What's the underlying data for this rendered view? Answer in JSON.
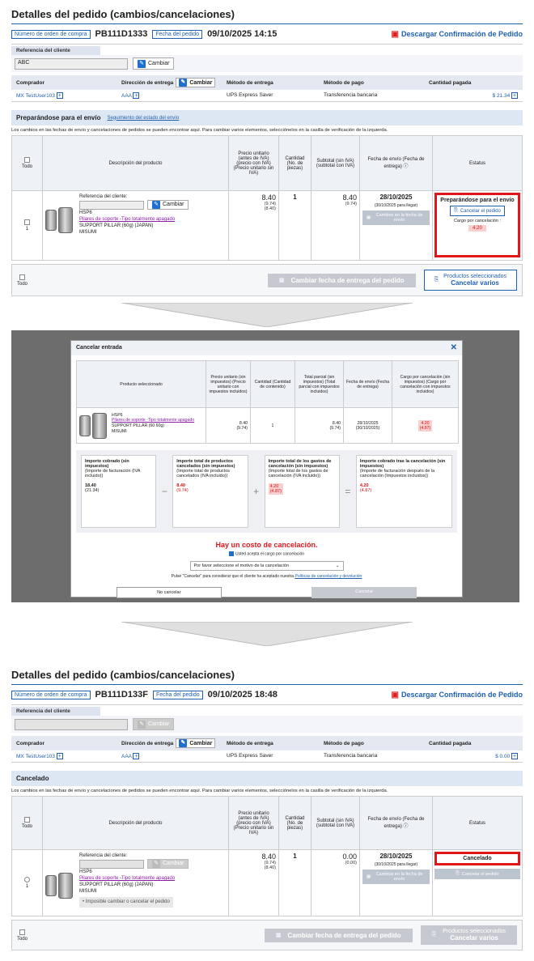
{
  "before": {
    "title": "Detalles del pedido (cambios/cancelaciones)",
    "order_tag": "Número de orden de compra",
    "order_no": "PB111D1333",
    "date_tag": "Fecha del pedido",
    "date": "09/10/2025 14:15",
    "pdf_link": "Descargar Confirmación de Pedido",
    "ref_label": "Referencia del cliente",
    "ref_value": "ABC",
    "cambiar": "Cambiar",
    "col_comprador": "Comprador",
    "col_direccion": "Dirección de entrega",
    "col_metodo_entrega": "Método de entrega",
    "col_metodo_pago": "Método de pago",
    "col_cantidad_pagada": "Cantidad pagada",
    "val_comprador": "MX TestUser103",
    "val_direccion": "AAA",
    "val_metodo_entrega": "UPS Express Saver",
    "val_metodo_pago": "Transferencia bancaria",
    "val_cantidad_pagada": "$ 21.34",
    "status_title": "Preparándose para el envío",
    "status_link": "Seguimiento del estado del envío",
    "note": "Los cambios en las fechas de envío y cancelaciones de pedidos se pueden encontrar aquí. Para cambiar varios elementos, selecciónelos en la casilla de verificación de la izquierda.",
    "th_todo": "Todo",
    "th_desc": "Descripción del producto",
    "th_precio": "Precio unitario (antes de IVA) (precio con IVA) (Precio unitario sin IVA)",
    "th_cantidad": "Cantidad (No. de piezas)",
    "th_subtotal": "Subtotal (sin IVA) (subtotal con IVA)",
    "th_fecha": "Fecha de envío (Fecha de entrega)",
    "th_estatus": "Estatus",
    "row_num": "1",
    "ref_cliente_lbl": "Referencia del cliente:",
    "sku": "HSP6",
    "prod_name": "Pilares de soporte -Tipo totalmente apagado",
    "prod_desc": "SUPPORT PILLAR (60g) (JAPAN)",
    "maker": "MISUMI",
    "price": "8.40",
    "price_iva": "(9.74)",
    "price_sin": "(8.40)",
    "qty": "1",
    "subtotal": "8.40",
    "subtotal_iva": "(9.74)",
    "ship_date": "28/10/2025",
    "deliv_date": "(30/10/2025 para llegar)",
    "btn_cambios_fecha": "Cambios en la fecha de envío",
    "status_text": "Preparándose para el envío",
    "cancel_btn": "Cancelar el pedido",
    "cargo_lbl": "Cargo por cancelación :",
    "cargo_val": "4.20",
    "bottom_change": "Cambiar fecha de entrega del pedido",
    "bottom_cancel_top": "Productos seleccionados",
    "bottom_cancel": "Cancelar varios"
  },
  "modal": {
    "title": "Cancelar entrada",
    "th_producto": "Producto seleccionado",
    "th_precio": "Precio unitario (sin impuestos) (Precio unitario con impuestos incluidos)",
    "th_cantidad": "Cantidad (Cantidad de contenido)",
    "th_total": "Total parcial (sin impuestos) (Total parcial con impuestos incluidos)",
    "th_fecha": "Fecha de envío (Fecha de entrega)",
    "th_cargo": "Cargo por cancelación (sin impuestos) (Cargo por cancelación con impuestos incluidos)",
    "sku": "HSP6",
    "prod_name": "Pilares de soporte -Tipo totalmente apagado",
    "prod_desc": "SUPPORT PILLAR (60 60g)",
    "maker": "MISUMI",
    "price": "8.40",
    "price_iva": "(9.74)",
    "qty": "1",
    "total": "8.40",
    "total_iva": "(9.74)",
    "fecha": "28/10/2025",
    "fecha2": "(30/10/2025)",
    "cargo": "4.20",
    "cargo_iva": "(4.87)",
    "box1_title": "Importe cobrado (sin impuestos)",
    "box1_sub": "(Importe de facturación (IVA incluido))",
    "box1_val": "18.40",
    "box1_val2": "(21.34)",
    "box2_title": "Importe total de productos cancelados (sin impuestos)",
    "box2_sub": "(Importe total de productos cancelados (IVA incluido))",
    "box2_val": "8.40",
    "box2_val2": "(9.74)",
    "box3_title": "Importe total de los gastos de cancelación (sin impuestos)",
    "box3_sub": "(Importe total de los gastos de cancelación (IVA incluido))",
    "box3_val": "4.20",
    "box3_val2": "(4.87)",
    "box4_title": "Importe cobrado tras la cancelación (sin impuestos)",
    "box4_sub": "(Importe de facturación después de la cancelación (Impuestos incluidos))",
    "box4_val": "4.20",
    "box4_val2": "(4.87)",
    "op_minus": "−",
    "op_plus": "+",
    "op_eq": "=",
    "warn": "Hay un costo de cancelación.",
    "accept": "Usted acepta el cargo por cancelación",
    "reason": "Por favor seleccione el motivo de la cancelación",
    "policy_pre": "Pulse \"Cancelar\" para considerar que el cliente ha aceptado nuestra",
    "policy_link": "Políticas de cancelación y devolución",
    "btn_no": "No cancelar",
    "btn_yes": "Cancelar"
  },
  "after": {
    "title": "Detalles del pedido (cambios/cancelaciones)",
    "order_tag": "Número de orden de compra",
    "order_no": "PB111D133F",
    "date_tag": "Fecha del pedido",
    "date": "09/10/2025 18:48",
    "pdf_link": "Descargar Confirmación de Pedido",
    "ref_label": "Referencia del cliente",
    "cambiar": "Cambiar",
    "col_comprador": "Comprador",
    "col_direccion": "Dirección de entrega",
    "col_metodo_entrega": "Método de entrega",
    "col_metodo_pago": "Método de pago",
    "col_cantidad_pagada": "Cantidad pagada",
    "val_comprador": "MX TestUser103",
    "val_direccion": "AAA",
    "val_metodo_entrega": "UPS Express Saver",
    "val_metodo_pago": "Transferencia bancaria",
    "val_cantidad_pagada": "$ 0.00",
    "status_title": "Cancelado",
    "note": "Los cambios en las fechas de envío y cancelaciones de pedidos se pueden encontrar aquí. Para cambiar varios elementos, selecciónelos en la casilla de verificación de la izquierda.",
    "th_todo": "Todo",
    "th_desc": "Descripción del producto",
    "th_precio": "Precio unitario (antes de IVA) (precio con IVA) (Precio unitario sin IVA)",
    "th_cantidad": "Cantidad (No. de piezas)",
    "th_subtotal": "Subtotal (sin IVA) (subtotal con IVA)",
    "th_fecha": "Fecha de envío (Fecha de entrega)",
    "th_estatus": "Estatus",
    "row_num": "1",
    "ref_cliente_lbl": "Referencia del cliente:",
    "sku": "HSP6",
    "prod_name": "Pilares de soporte -Tipo totalmente apagado",
    "prod_desc": "SUPPORT PILLAR (60g) (JAPAN)",
    "maker": "MISUMI",
    "price": "8.40",
    "price_iva": "(9.74)",
    "price_sin": "(8.40)",
    "qty": "1",
    "subtotal": "0.00",
    "subtotal_iva": "(0.00)",
    "ship_date": "28/10/2025",
    "deliv_date": "(30/10/2025 para llegar)",
    "btn_cambios_fecha": "Cambios en la fecha de envío",
    "impossible": "• Imposible cambiar o cancelar el pedido",
    "status_text": "Cancelado",
    "cancel_btn": "Cancelar el pedido",
    "bottom_change": "Cambiar fecha de entrega del pedido",
    "bottom_cancel_top": "Productos seleccionados",
    "bottom_cancel": "Cancelar varios"
  }
}
